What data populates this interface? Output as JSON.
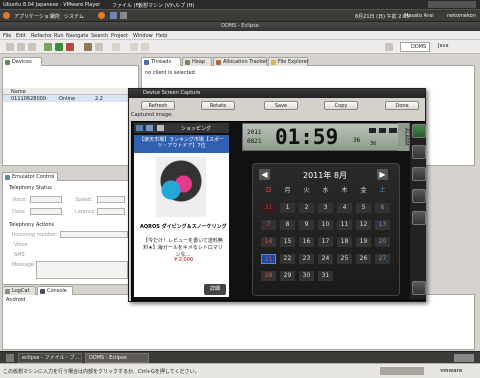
{
  "vm": {
    "title": "Ubuntu 8.04 Japanese - VMware Player",
    "menus": [
      "ファイル (F)",
      "仮想マシン (V)",
      "ヘルプ (H)"
    ]
  },
  "panel": {
    "menus": [
      "アプリケーション",
      "場所",
      "システム"
    ],
    "clock": "8月21日 (日) 午前 2:05",
    "user": "Masato Arai",
    "network": "nekomekon"
  },
  "window": {
    "title": "DDMS - Eclipse"
  },
  "menubar": [
    "File",
    "Edit",
    "Refactor",
    "Run",
    "Navigate",
    "Search",
    "Project",
    "Window",
    "Help"
  ],
  "perspectives": [
    "DDMS",
    "Java"
  ],
  "devices_view": {
    "tab": "Devices",
    "col_name": "Name",
    "row": {
      "name": "01110628000",
      "status": "Online",
      "col3": "2.2"
    }
  },
  "tabs_top": [
    {
      "label": "Threads"
    },
    {
      "label": "Heap"
    },
    {
      "label": "Allocation Tracker"
    },
    {
      "label": "File Explorer"
    }
  ],
  "no_client": "no client is selected",
  "emulator": {
    "tab": "Emulator Control",
    "telephony_status": "Telephony Status",
    "voice": "Voice:",
    "speed": "Speed:",
    "data": "Data:",
    "latency": "Latency:",
    "telephony_actions": "Telephony Actions",
    "incoming_number": "Incoming number:",
    "voice_radio": "Voice",
    "sms_radio": "SMS",
    "message": "Message:"
  },
  "bottom_tabs": [
    {
      "label": "LogCat"
    },
    {
      "label": "Console"
    }
  ],
  "console_label": "Android",
  "dialog": {
    "title": "Device Screen Capture",
    "buttons": {
      "refresh": "Refresh",
      "rotate": "Rotate",
      "save": "Save",
      "copy": "Copy",
      "done": "Done"
    },
    "captured": "Captured image:"
  },
  "phone": {
    "shopping": "ショッピング",
    "banner": "【楽天市場】ランキング市場【スポーツ・アウトドア】7位",
    "product_title": "AQROS ダイビング＆スノーケリング",
    "product_desc": "【今だけ！レビューを書いて送料無料★】海ガールをキメるレトロマリンな…",
    "price": "¥ 2,000",
    "details_button": "詳細",
    "clock_date_top": "2011",
    "clock_date_bottom": "0821",
    "clock_time": "01:59",
    "clock_seconds": "36",
    "alarm": "ALARM",
    "calendar": {
      "month": "2011年 8月",
      "weekdays": [
        "日",
        "月",
        "火",
        "水",
        "木",
        "金",
        "土"
      ],
      "weeks": [
        [
          "31",
          "1",
          "2",
          "3",
          "4",
          "5",
          "6"
        ],
        [
          "7",
          "8",
          "9",
          "10",
          "11",
          "12",
          "13"
        ],
        [
          "14",
          "15",
          "16",
          "17",
          "18",
          "19",
          "20"
        ],
        [
          "21",
          "22",
          "23",
          "24",
          "25",
          "26",
          "27"
        ],
        [
          "28",
          "29",
          "30",
          "31",
          "",
          "",
          ""
        ]
      ]
    }
  },
  "taskbar": [
    {
      "label": "eclipse - ファイル・ブ..."
    },
    {
      "label": "DDMS - Eclipse"
    }
  ],
  "status_text": "この仮想マシンに入力を行う場合は内部をクリックするか、Ctrl+Gを押してください。",
  "vmware_logo": "vmware"
}
